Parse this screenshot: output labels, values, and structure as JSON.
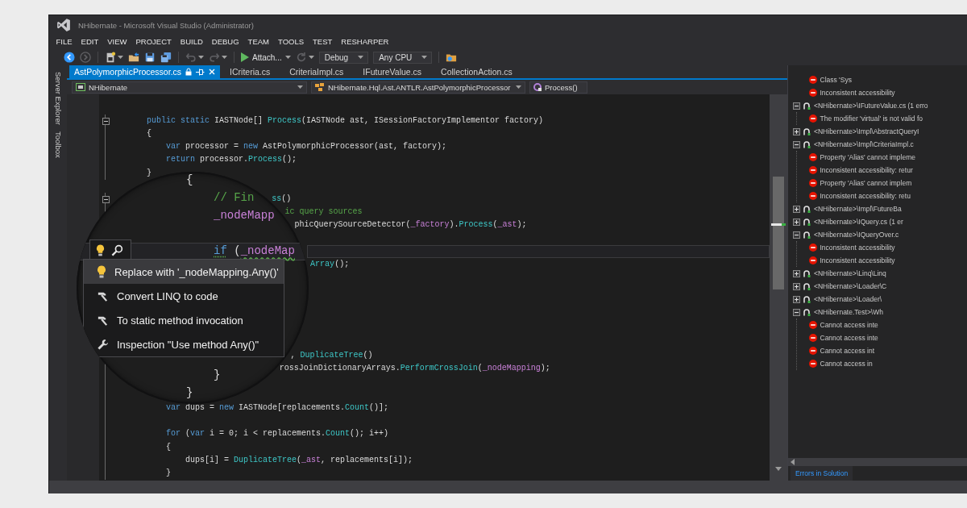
{
  "window": {
    "title": "NHibernate - Microsoft Visual Studio (Administrator)"
  },
  "menu": [
    "FILE",
    "EDIT",
    "VIEW",
    "PROJECT",
    "BUILD",
    "DEBUG",
    "TEAM",
    "TOOLS",
    "TEST",
    "RESHARPER"
  ],
  "toolbar": [
    [
      {
        "kind": "back",
        "disabled": false
      },
      {
        "kind": "forward",
        "disabled": true
      }
    ],
    [
      {
        "kind": "new_project",
        "disabled": false
      },
      {
        "kind": "open",
        "disabled": false
      },
      {
        "kind": "save",
        "disabled": false
      },
      {
        "kind": "save_all",
        "disabled": false
      }
    ],
    [
      {
        "kind": "undo",
        "disabled": true
      },
      {
        "kind": "redo",
        "disabled": true
      }
    ],
    [
      {
        "kind": "start",
        "label": "Attach...",
        "disabled": false
      },
      {
        "kind": "refresh",
        "disabled": true
      },
      {
        "kind": "combo",
        "value": "Debug",
        "disabled": false
      },
      {
        "kind": "combo",
        "value": "Any CPU",
        "disabled": false
      }
    ],
    [
      {
        "kind": "find_in_files",
        "disabled": false
      }
    ]
  ],
  "side_tabs": [
    "Server Explorer",
    "Toolbox"
  ],
  "document_tabs": [
    {
      "label": "AstPolymorphicProcessor.cs",
      "selected": true
    },
    {
      "label": "ICriteria.cs",
      "selected": false
    },
    {
      "label": "CriteriaImpl.cs",
      "selected": false
    },
    {
      "label": "IFutureValue.cs",
      "selected": false
    },
    {
      "label": "CollectionAction.cs",
      "selected": false
    }
  ],
  "navigation_bar": {
    "project": "NHibernate",
    "type": "NHibernate.Hql.Ast.ANTLR.AstPolymorphicProcessor",
    "member": "Process()"
  },
  "editor": {
    "lines": [
      {
        "kind": "line",
        "expanded": true,
        "tokens": [
          {
            "kind": "keyword",
            "text": "public static"
          },
          {
            "kind": "plain",
            "text": " IASTNode[] "
          },
          {
            "kind": "method",
            "text": "Process"
          },
          {
            "kind": "plain",
            "text": "(IASTNode ast, ISessionFactoryImplementor factory)"
          }
        ]
      },
      {
        "kind": "line",
        "tokens": [
          {
            "kind": "plain",
            "text": "{"
          }
        ]
      },
      {
        "kind": "block",
        "lines": [
          {
            "kind": "line",
            "tokens": [
              {
                "kind": "keyword",
                "text": "var"
              },
              {
                "kind": "plain",
                "text": " processor = "
              },
              {
                "kind": "keyword",
                "text": "new"
              },
              {
                "kind": "plain",
                "text": " AstPolymorphicProcessor(ast, factory);"
              }
            ]
          },
          {
            "kind": "line",
            "tokens": [
              {
                "kind": "keyword",
                "text": "return"
              },
              {
                "kind": "plain",
                "text": " processor."
              },
              {
                "kind": "method",
                "text": "Process"
              },
              {
                "kind": "plain",
                "text": "();"
              }
            ]
          }
        ]
      },
      {
        "kind": "line",
        "tokens": [
          {
            "kind": "plain",
            "text": "}"
          }
        ]
      },
      {
        "kind": "blank"
      },
      {
        "kind": "cut",
        "expanded": true,
        "tokens": [
          {
            "kind": "method",
            "text": "ss"
          },
          {
            "kind": "plain",
            "text": "()"
          }
        ]
      },
      {
        "kind": "cut",
        "tokens": [
          {
            "kind": "comment",
            "text": "ic query sources"
          }
        ]
      },
      {
        "kind": "cut",
        "tokens": [
          {
            "kind": "plain",
            "text": "phicQuerySourceDetector("
          },
          {
            "kind": "field",
            "text": "_factory"
          },
          {
            "kind": "plain",
            "text": ")."
          },
          {
            "kind": "method",
            "text": "Process"
          },
          {
            "kind": "plain",
            "text": "("
          },
          {
            "kind": "field",
            "text": "_ast"
          },
          {
            "kind": "plain",
            "text": ");"
          }
        ]
      },
      {
        "kind": "blank"
      },
      {
        "kind": "current"
      },
      {
        "kind": "cut",
        "tokens": [
          {
            "kind": "method",
            "text": "Array"
          },
          {
            "kind": "plain",
            "text": "();"
          }
        ]
      },
      {
        "kind": "blank"
      },
      {
        "kind": "blank"
      },
      {
        "kind": "blank"
      },
      {
        "kind": "blank"
      },
      {
        "kind": "blank"
      },
      {
        "kind": "blank"
      },
      {
        "kind": "cut",
        "tokens": [
          {
            "kind": "plain",
            "text": ", "
          },
          {
            "kind": "method",
            "text": "DuplicateTree"
          },
          {
            "kind": "plain",
            "text": "()"
          }
        ]
      },
      {
        "kind": "cut",
        "tokens": [
          {
            "kind": "plain",
            "text": "rossJoinDictionaryArrays."
          },
          {
            "kind": "method",
            "text": "PerformCrossJoin"
          },
          {
            "kind": "plain",
            "text": "("
          },
          {
            "kind": "field",
            "text": "_nodeMapping"
          },
          {
            "kind": "plain",
            "text": ");"
          }
        ]
      },
      {
        "kind": "blank"
      },
      {
        "kind": "blank"
      },
      {
        "kind": "block",
        "lines": [
          {
            "kind": "line",
            "tokens": [
              {
                "kind": "keyword",
                "text": "var"
              },
              {
                "kind": "plain",
                "text": " dups = "
              },
              {
                "kind": "keyword",
                "text": "new"
              },
              {
                "kind": "plain",
                "text": " IASTNode[replacements."
              },
              {
                "kind": "method",
                "text": "Count"
              },
              {
                "kind": "plain",
                "text": "()];"
              }
            ]
          },
          {
            "kind": "blank"
          },
          {
            "kind": "line",
            "tokens": [
              {
                "kind": "keyword",
                "text": "for"
              },
              {
                "kind": "plain",
                "text": " ("
              },
              {
                "kind": "keyword",
                "text": "var"
              },
              {
                "kind": "plain",
                "text": " i = 0; i < replacements."
              },
              {
                "kind": "method",
                "text": "Count"
              },
              {
                "kind": "plain",
                "text": "(); i++)"
              }
            ]
          },
          {
            "kind": "line",
            "tokens": [
              {
                "kind": "plain",
                "text": "{"
              }
            ]
          },
          {
            "kind": "block",
            "lines": [
              {
                "kind": "line",
                "tokens": [
                  {
                    "kind": "plain",
                    "text": "dups[i] = "
                  },
                  {
                    "kind": "method",
                    "text": "DuplicateTree"
                  },
                  {
                    "kind": "plain",
                    "text": "("
                  },
                  {
                    "kind": "field",
                    "text": "_ast"
                  },
                  {
                    "kind": "plain",
                    "text": ", replacements[i]);"
                  }
                ]
              }
            ]
          },
          {
            "kind": "line",
            "tokens": [
              {
                "kind": "plain",
                "text": "}"
              }
            ]
          }
        ]
      }
    ],
    "magnifier": {
      "lines": [
        {
          "kind": "line",
          "tokens": [
            {
              "kind": "plain",
              "text": "{"
            }
          ]
        },
        {
          "kind": "block",
          "lines": [
            {
              "kind": "line",
              "tokens": [
                {
                  "kind": "comment",
                  "text": "// Fin"
                }
              ]
            },
            {
              "kind": "line",
              "tokens": [
                {
                  "kind": "field",
                  "text": "_nodeMapp"
                }
              ]
            },
            {
              "kind": "blank"
            },
            {
              "kind": "current",
              "tokens": [
                {
                  "kind": "keyword_hint",
                  "text": "if"
                },
                {
                  "kind": "plain",
                  "text": " ("
                },
                {
                  "kind": "field_warning",
                  "text": "_nodeMap"
                }
              ]
            },
            {
              "kind": "blank"
            },
            {
              "kind": "blank"
            },
            {
              "kind": "blank"
            },
            {
              "kind": "blank"
            },
            {
              "kind": "blank"
            },
            {
              "kind": "blank"
            },
            {
              "kind": "line",
              "tokens": [
                {
                  "kind": "plain",
                  "text": "}"
                }
              ]
            }
          ]
        },
        {
          "kind": "line",
          "tokens": [
            {
              "kind": "plain",
              "text": "}"
            }
          ]
        }
      ],
      "menu": [
        {
          "kind": "quick_fix",
          "label": "Replace with '_nodeMapping.Any()'",
          "selected": true
        },
        {
          "kind": "context_action",
          "label": "Convert LINQ to code",
          "selected": false
        },
        {
          "kind": "context_action",
          "label": "To static method invocation",
          "selected": false
        },
        {
          "kind": "inspection",
          "label": "Inspection \"Use method Any()\"",
          "selected": false
        }
      ]
    }
  },
  "error_panel": {
    "tree": [
      {
        "kind": "error",
        "text": "Class 'Sys"
      },
      {
        "kind": "error",
        "text": "Inconsistent accessibility"
      },
      {
        "kind": "file",
        "text": "<NHibernate>\\IFutureValue.cs (1 erro",
        "expanded": true,
        "children": [
          {
            "kind": "error",
            "text": "The modifier 'virtual' is not valid fo"
          }
        ]
      },
      {
        "kind": "file",
        "text": "<NHibernate>\\Impl\\AbstractQueryI",
        "expanded": false
      },
      {
        "kind": "file",
        "text": "<NHibernate>\\Impl\\CriteriaImpl.c",
        "expanded": true,
        "children": [
          {
            "kind": "error",
            "text": "Property 'Alias' cannot impleme"
          },
          {
            "kind": "error",
            "text": "Inconsistent accessibility: retur"
          },
          {
            "kind": "error",
            "text": "Property 'Alias' cannot implem"
          },
          {
            "kind": "error",
            "text": "Inconsistent accessibility: retu"
          }
        ]
      },
      {
        "kind": "file",
        "text": "<NHibernate>\\Impl\\FutureBa",
        "expanded": false
      },
      {
        "kind": "file",
        "text": "<NHibernate>\\IQuery.cs (1 er",
        "expanded": false
      },
      {
        "kind": "file",
        "text": "<NHibernate>\\IQueryOver.c",
        "expanded": true,
        "children": [
          {
            "kind": "error",
            "text": "Inconsistent accessibility"
          },
          {
            "kind": "error",
            "text": "Inconsistent accessibility"
          }
        ]
      },
      {
        "kind": "file",
        "text": "<NHibernate>\\Linq\\Linq",
        "expanded": false
      },
      {
        "kind": "file",
        "text": "<NHibernate>\\Loader\\C",
        "expanded": false
      },
      {
        "kind": "file",
        "text": "<NHibernate>\\Loader\\",
        "expanded": false
      },
      {
        "kind": "file",
        "text": "<NHibernate.Test>\\Wh",
        "expanded": true,
        "children": [
          {
            "kind": "error",
            "text": "Cannot access inte"
          },
          {
            "kind": "error",
            "text": "Cannot access inte"
          },
          {
            "kind": "error",
            "text": "Cannot access int"
          },
          {
            "kind": "error",
            "text": "Cannot access in"
          }
        ]
      }
    ],
    "tabs": [
      {
        "label": "Errors in Solution",
        "selected": true
      }
    ]
  }
}
